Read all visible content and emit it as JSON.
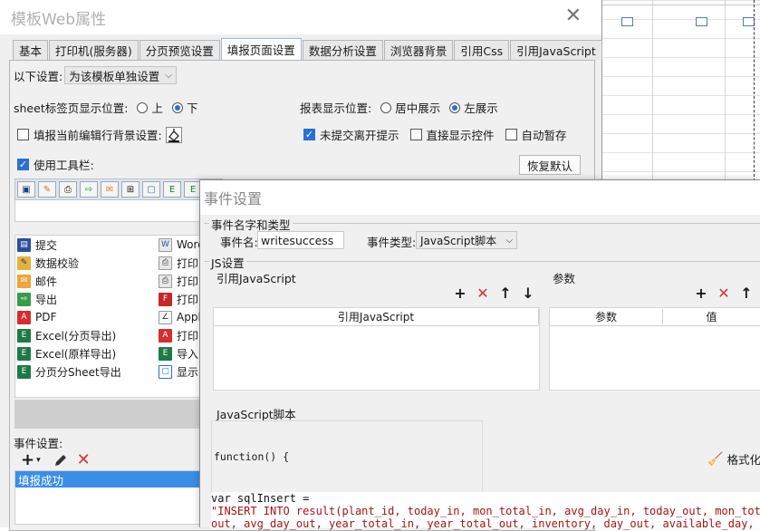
{
  "main_window": {
    "title": "模板Web属性",
    "tabs": [
      {
        "label": "基本",
        "active": false
      },
      {
        "label": "打印机(服务器)",
        "active": false
      },
      {
        "label": "分页预览设置",
        "active": false
      },
      {
        "label": "填报页面设置",
        "active": true
      },
      {
        "label": "数据分析设置",
        "active": false
      },
      {
        "label": "浏览器背景",
        "active": false
      },
      {
        "label": "引用Css",
        "active": false
      },
      {
        "label": "引用JavaScript",
        "active": false
      }
    ],
    "setting_scope_label": "以下设置:",
    "setting_scope_value": "为该模板单独设置",
    "sheet_tab_position_label": "sheet标签页显示位置:",
    "sheet_tab_position_options": [
      "上",
      "下"
    ],
    "sheet_tab_position_selected": "下",
    "report_position_label": "报表显示位置:",
    "report_position_options": [
      "居中展示",
      "左展示"
    ],
    "report_position_selected": "左展示",
    "fill_row_bg_label": "填报当前编辑行背景设置:",
    "fill_row_bg_checked": false,
    "unsubmitted_prompt_label": "未提交离开提示",
    "unsubmitted_prompt_checked": true,
    "direct_show_control_label": "直接显示控件",
    "direct_show_control_checked": false,
    "auto_save_label": "自动暂存",
    "auto_save_checked": false,
    "use_toolbar_label": "使用工具栏:",
    "use_toolbar_checked": true,
    "reset_button": "恢复默认",
    "tool_items_left": [
      "提交",
      "数据校验",
      "邮件",
      "导出",
      "PDF",
      "Excel(分页导出)",
      "Excel(原样导出)",
      "分页分Sheet导出"
    ],
    "tool_items_right": [
      "Word",
      "打印",
      "打印",
      "打印",
      "Apple",
      "打印",
      "导入",
      "显示"
    ],
    "event_settings_label": "事件设置:",
    "event_list": [
      "填报成功"
    ]
  },
  "event_window": {
    "title": "事件设置",
    "name_type_group": "事件名字和类型",
    "event_name_label": "事件名:",
    "event_name_value": "writesuccess",
    "event_type_label": "事件类型:",
    "event_type_value": "JavaScript脚本",
    "js_group": "JS设置",
    "ref_js_label": "引用JavaScript",
    "params_label": "参数",
    "ref_js_column": "引用JavaScript",
    "param_columns": [
      "参数",
      "值"
    ],
    "js_script_label": "JavaScript脚本",
    "function_signature": "function() {",
    "format_button": "格式化",
    "code_lines": [
      "var sqlInsert =",
      "\"INSERT INTO result(plant_id, today_in, mon_total_in, avg_day_in, today_out, mon_total",
      "out, avg_day_out, year_total_in, year_total_out, inventory, day_out, available_day,"
    ]
  },
  "colors": {
    "accent": "#2a6fd6",
    "selected_row": "#3a8ee6",
    "delete_red": "#d9302c",
    "code_string": "#a31515"
  }
}
